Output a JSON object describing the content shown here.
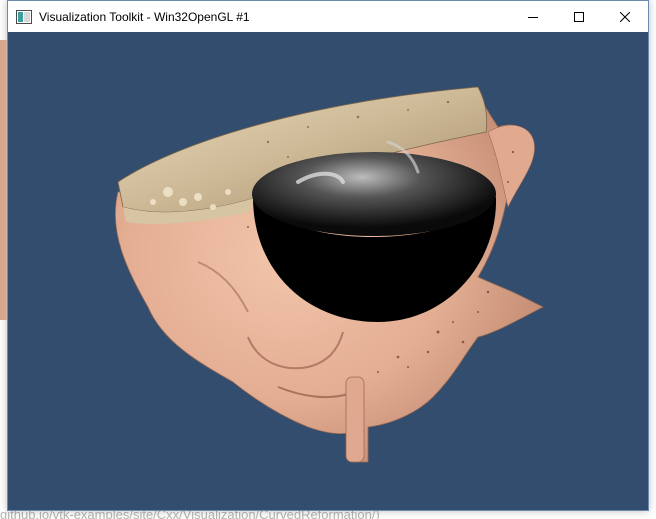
{
  "window": {
    "title": "Visualization Toolkit - Win32OpenGL #1",
    "background_color": "#324d6e"
  },
  "controls": {
    "minimize_icon": "minimize-icon",
    "maximize_icon": "maximize-icon",
    "close_icon": "close-icon"
  },
  "scene": {
    "description_icon": "rendered-head-with-hemisphere",
    "skin_color": "#e7b49a",
    "bone_color": "#d8c6a7",
    "sphere_color": "#000000"
  },
  "background_page": {
    "url_text": "github.io/vtk-examples/site/Cxx/Visualization/CurvedReformation/)"
  }
}
